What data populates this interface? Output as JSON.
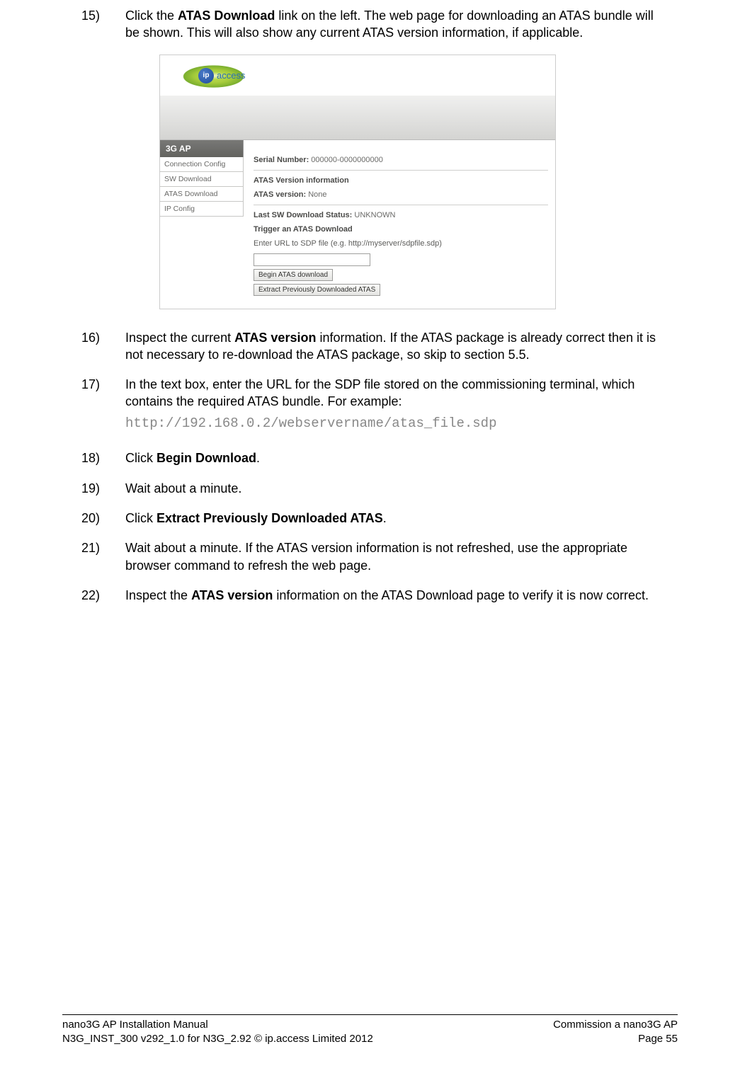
{
  "steps": {
    "s15": {
      "num": "15)",
      "p1a": "Click the ",
      "p1b": "ATAS Download",
      "p1c": " link on the left. The web page for downloading an ATAS bundle will be shown. This will also show any current ATAS version information, if applicable."
    },
    "s16": {
      "num": "16)",
      "p1a": "Inspect the current ",
      "p1b": "ATAS version",
      "p1c": " information. If the ATAS package is already correct then it is not necessary to re-download the ATAS package, so skip to section 5.5."
    },
    "s17": {
      "num": "17)",
      "p1": "In the text box, enter the URL for the SDP file stored on the commissioning terminal, which contains the required ATAS bundle. For example:",
      "code": "http://192.168.0.2/webservername/atas_file.sdp"
    },
    "s18": {
      "num": "18)",
      "p1a": "Click ",
      "p1b": "Begin Download",
      "p1c": "."
    },
    "s19": {
      "num": "19)",
      "p1": "Wait about a minute."
    },
    "s20": {
      "num": "20)",
      "p1a": "Click ",
      "p1b": "Extract Previously Downloaded ATAS",
      "p1c": "."
    },
    "s21": {
      "num": "21)",
      "p1": "Wait about a minute. If the ATAS version information is not refreshed, use the appropriate browser command to refresh the web page."
    },
    "s22": {
      "num": "22)",
      "p1a": "Inspect the ",
      "p1b": "ATAS version",
      "p1c": " information on the ATAS Download page to verify it is now correct."
    }
  },
  "shot": {
    "logo_ip": "ip",
    "logo_access": "access",
    "side_head": "3G AP",
    "side_items": [
      "Connection Config",
      "SW Download",
      "ATAS Download",
      "IP Config"
    ],
    "serial_lbl": "Serial Number:",
    "serial_val": " 000000-0000000000",
    "atas_info_lbl": "ATAS Version information",
    "atas_ver_lbl": "ATAS version:",
    "atas_ver_val": " None",
    "lastdl_lbl": "Last SW Download Status:",
    "lastdl_val": " UNKNOWN",
    "trigger_lbl": "Trigger an ATAS Download",
    "enter_url": "Enter URL to SDP file (e.g. http://myserver/sdpfile.sdp)",
    "btn_begin": "Begin ATAS download",
    "btn_extract": "Extract Previously Downloaded ATAS"
  },
  "footer": {
    "l1": "nano3G AP Installation Manual",
    "l2": "N3G_INST_300 v292_1.0 for N3G_2.92 © ip.access Limited 2012",
    "r1": "Commission a nano3G AP",
    "r2": "Page 55"
  }
}
